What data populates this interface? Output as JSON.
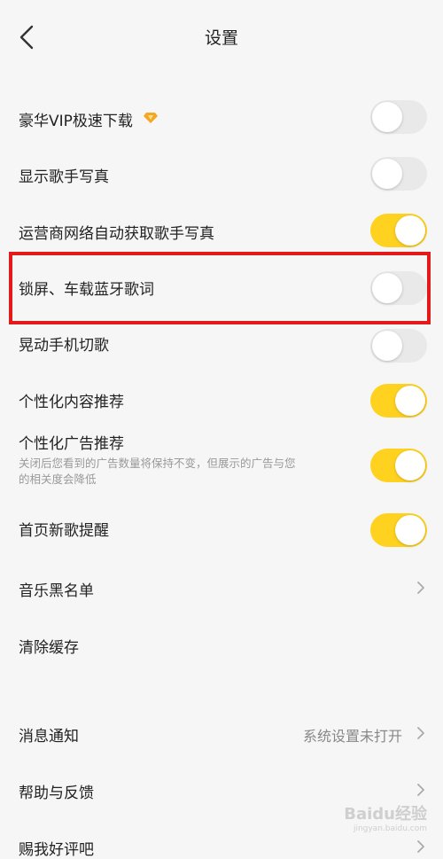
{
  "header": {
    "title": "设置"
  },
  "toggles": [
    {
      "label": "豪华VIP极速下载",
      "on": false
    },
    {
      "label": "显示歌手写真",
      "on": false
    },
    {
      "label": "运营商网络自动获取歌手写真",
      "on": true
    },
    {
      "label": "锁屏、车载蓝牙歌词",
      "on": false
    },
    {
      "label": "晃动手机切歌",
      "on": false
    },
    {
      "label": "个性化内容推荐",
      "on": true
    },
    {
      "label": "个性化广告推荐",
      "description": "关闭后您看到的广告数量将保持不变，但展示的广告与您的相关度会降低",
      "on": true
    },
    {
      "label": "首页新歌提醒",
      "on": true
    }
  ],
  "links": [
    {
      "label": "音乐黑名单"
    },
    {
      "label": "清除缓存"
    }
  ],
  "section2": [
    {
      "label": "消息通知",
      "value": "系统设置未打开"
    },
    {
      "label": "帮助与反馈"
    },
    {
      "label": "赐我好评吧"
    }
  ],
  "watermark": {
    "text1": "Baidu经验",
    "text2": "jingyan.baidu.com"
  },
  "colors": {
    "toggle_on": "#ffd21f",
    "toggle_off": "#e9e9e9",
    "highlight": "#e21a1a",
    "vip": "#f5a623"
  }
}
